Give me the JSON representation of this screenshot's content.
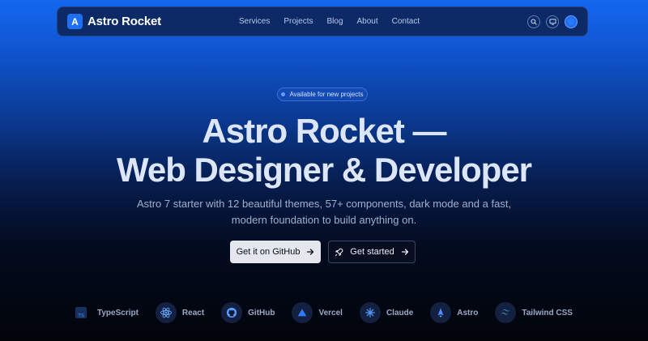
{
  "brand": {
    "logo_letter": "A",
    "name": "Astro Rocket"
  },
  "nav": {
    "items": [
      "Services",
      "Projects",
      "Blog",
      "About",
      "Contact"
    ]
  },
  "badge": {
    "text": "Available for new projects"
  },
  "hero": {
    "title_line1": "Astro Rocket —",
    "title_line2": "Web Designer & Developer",
    "subtitle_line1": "Astro 7 starter with 12 beautiful themes, 57+ components, dark mode and a fast,",
    "subtitle_line2": "modern foundation to build anything on."
  },
  "cta": {
    "primary_label": "Get it on GitHub",
    "secondary_label": "Get started"
  },
  "tech_stack": [
    {
      "label": "TypeScript",
      "icon": "typescript-icon",
      "color": "#3178c6"
    },
    {
      "label": "React",
      "icon": "react-icon",
      "color": "#61dafb"
    },
    {
      "label": "GitHub",
      "icon": "github-icon",
      "color": "#5b9bff"
    },
    {
      "label": "Vercel",
      "icon": "vercel-icon",
      "color": "#2f7dff"
    },
    {
      "label": "Claude",
      "icon": "claude-icon",
      "color": "#4f9bff"
    },
    {
      "label": "Astro",
      "icon": "astro-icon",
      "color": "#4f8dff"
    },
    {
      "label": "Tailwind CSS",
      "icon": "tailwind-icon",
      "color": "#38bdf8"
    }
  ],
  "colors": {
    "accent": "#1f6ff5",
    "nav_bg": "#0c2a66"
  }
}
